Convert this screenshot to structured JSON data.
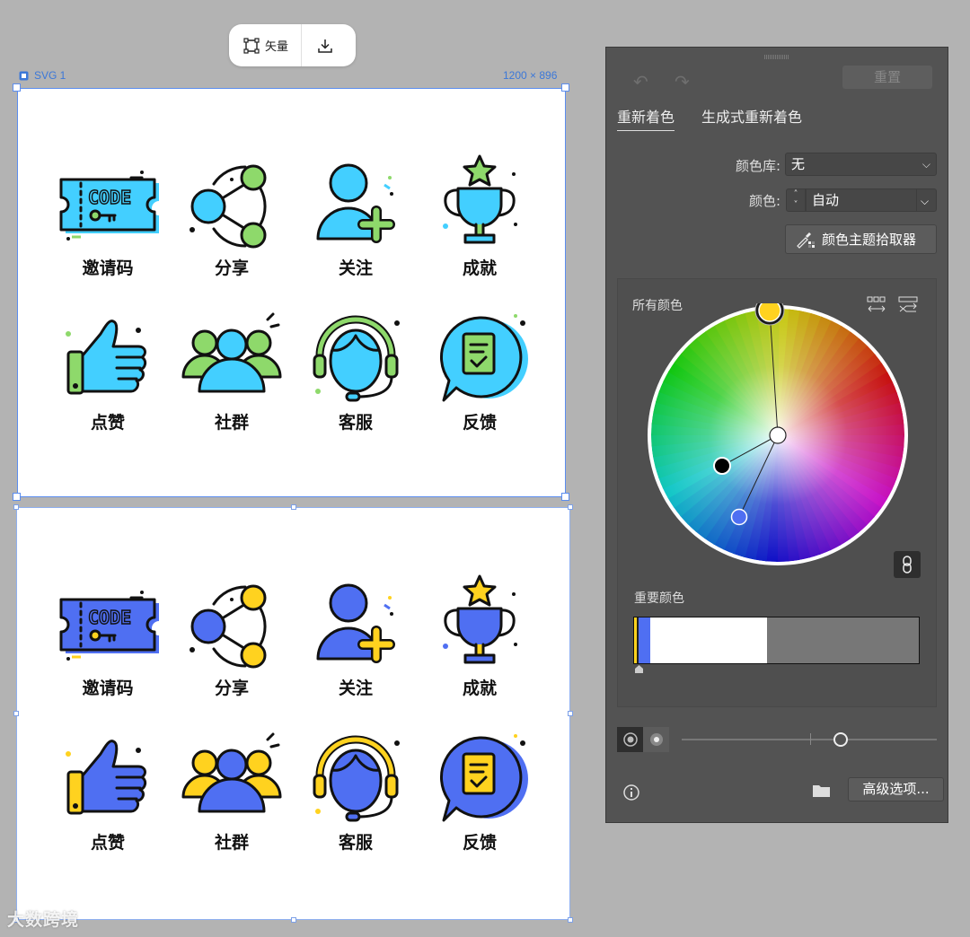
{
  "toolbar": {
    "vector_label": "矢量"
  },
  "artboards": [
    {
      "name": "SVG 1",
      "size": "1200 × 896"
    }
  ],
  "icons": {
    "labels": [
      "邀请码",
      "分享",
      "关注",
      "成就",
      "点赞",
      "社群",
      "客服",
      "反馈"
    ],
    "code_text": "CODE"
  },
  "themes": {
    "original": {
      "primary": "#43cfff",
      "secondary": "#8ed96b"
    },
    "recolored": {
      "primary": "#4f6ff2",
      "secondary": "#ffd21f"
    }
  },
  "watermark": "大数跨境",
  "panel": {
    "reset_label": "重置",
    "tabs": [
      "重新着色",
      "生成式重新着色"
    ],
    "color_library_label": "颜色库:",
    "color_library_value": "无",
    "colors_label": "颜色:",
    "colors_value": "自动",
    "picker_button": "颜色主题拾取器",
    "all_colors_label": "所有颜色",
    "important_colors_label": "重要颜色",
    "advanced_button": "高级选项...",
    "important_colors": [
      "#4f6ff2",
      "#ffd21f",
      "#ffffff",
      "#777777"
    ]
  }
}
